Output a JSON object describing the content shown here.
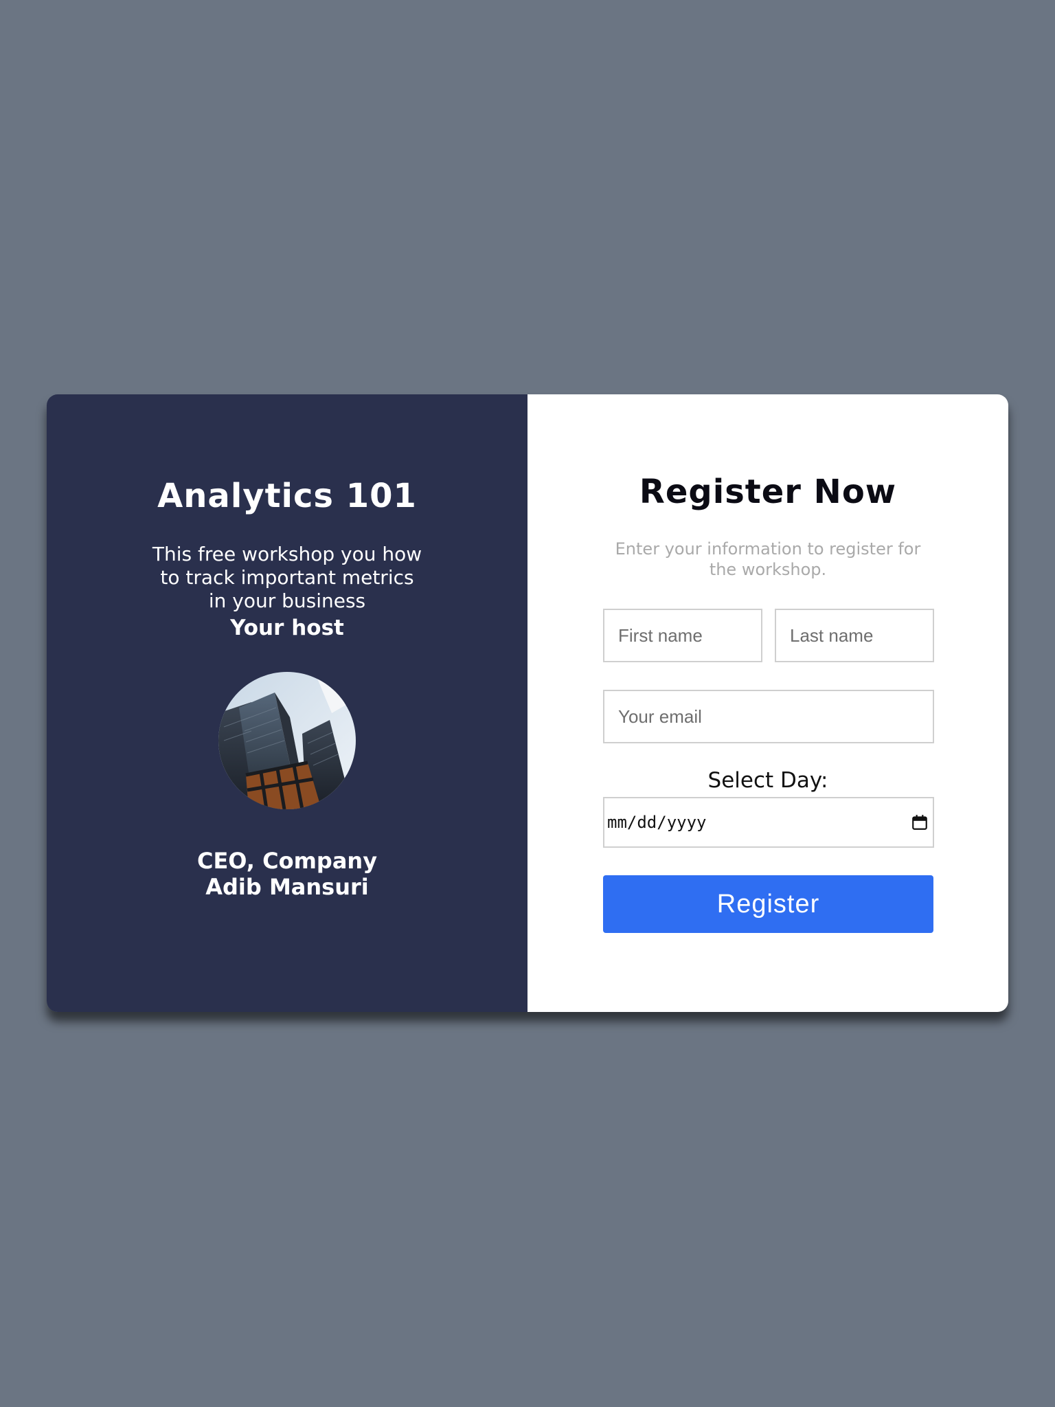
{
  "workshop": {
    "title": "Analytics 101",
    "description": "This free workshop you how to track important metrics in your business",
    "host_label": "Your host",
    "host_role": "CEO, Company",
    "host_name": "Adib Mansuri",
    "avatar_icon": "buildings-photo"
  },
  "register": {
    "title": "Register Now",
    "description": "Enter your information to register for the workshop.",
    "first_name_placeholder": "First name",
    "last_name_placeholder": "Last name",
    "email_placeholder": "Your email",
    "day_label": "Select Day:",
    "date_placeholder": "mm/dd/yyyy",
    "calendar_icon": "calendar-icon",
    "button_label": "Register"
  },
  "colors": {
    "page_background": "#6b7583",
    "left_panel": "#2a304d",
    "right_panel": "#ffffff",
    "button": "#2f6ef2",
    "muted_text": "#a9a9a9"
  }
}
